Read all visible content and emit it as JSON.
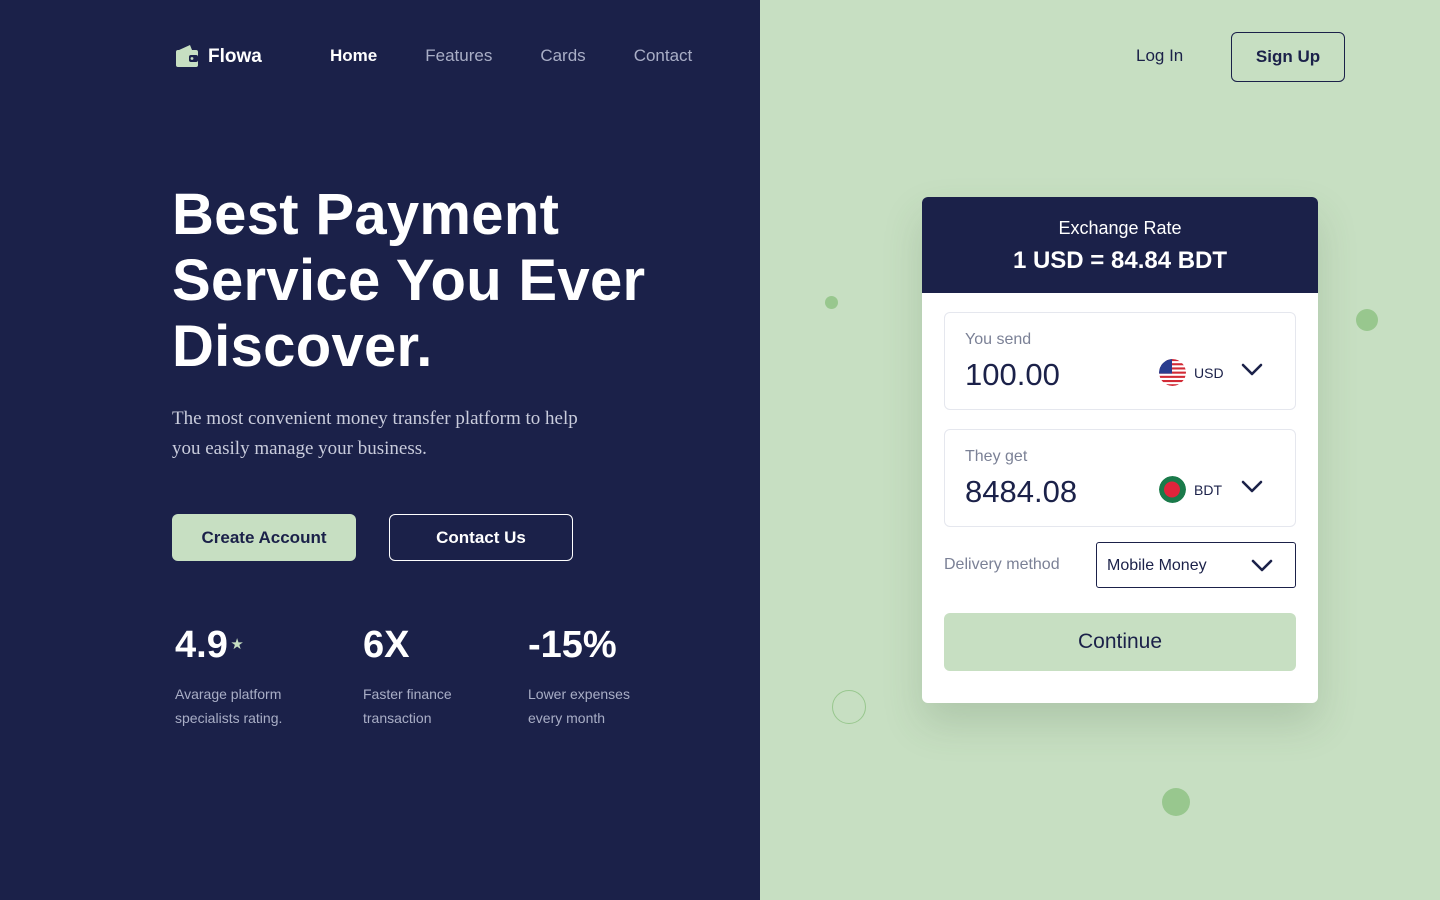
{
  "brand": {
    "name": "Flowa",
    "icon": "wallet-icon",
    "accent": "#c7dfc2",
    "navy": "#1b2149"
  },
  "nav": {
    "items": [
      {
        "label": "Home",
        "active": true
      },
      {
        "label": "Features",
        "active": false
      },
      {
        "label": "Cards",
        "active": false
      },
      {
        "label": "Contact",
        "active": false
      }
    ],
    "login": "Log In",
    "signup": "Sign Up"
  },
  "hero": {
    "title_lines": [
      "Best Payment",
      "Service You Ever",
      "Discover."
    ],
    "subtitle_lines": [
      "The most convenient money transfer platform to help",
      "you easily manage your business."
    ],
    "primary_button": "Create Account",
    "secondary_button": "Contact Us"
  },
  "stats": [
    {
      "value": "4.9",
      "star": "★",
      "label_lines": [
        "Avarage platform",
        "specialists rating."
      ]
    },
    {
      "value": "6X",
      "label_lines": [
        "Faster finance",
        "transaction"
      ]
    },
    {
      "value": "-15%",
      "label_lines": [
        "Lower expenses",
        "every month"
      ]
    }
  ],
  "exchange": {
    "rate_title": "Exchange Rate",
    "rate_value": "1 USD = 84.84 BDT",
    "send": {
      "label": "You send",
      "amount": "100.00",
      "currency": "USD",
      "flag": "us-flag-icon"
    },
    "receive": {
      "label": "They get",
      "amount": "8484.08",
      "currency": "BDT",
      "flag": "bd-flag-icon"
    },
    "delivery": {
      "label": "Delivery method",
      "selected": "Mobile Money"
    },
    "continue": "Continue"
  }
}
